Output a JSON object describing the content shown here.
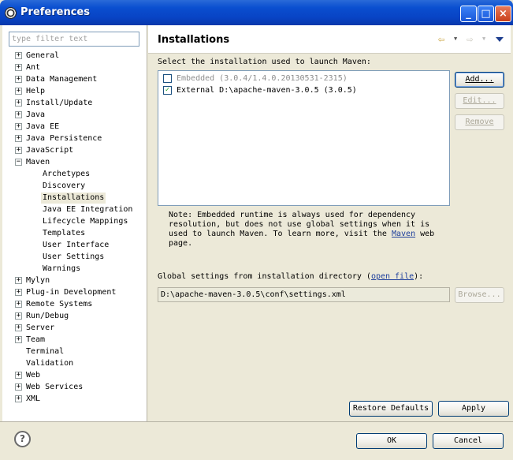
{
  "window": {
    "title": "Preferences"
  },
  "filter": {
    "placeholder": "type filter text"
  },
  "tree": [
    {
      "label": "General",
      "expandable": true
    },
    {
      "label": "Ant",
      "expandable": true
    },
    {
      "label": "Data Management",
      "expandable": true
    },
    {
      "label": "Help",
      "expandable": true
    },
    {
      "label": "Install/Update",
      "expandable": true
    },
    {
      "label": "Java",
      "expandable": true
    },
    {
      "label": "Java EE",
      "expandable": true
    },
    {
      "label": "Java Persistence",
      "expandable": true
    },
    {
      "label": "JavaScript",
      "expandable": true
    },
    {
      "label": "Maven",
      "expandable": true,
      "expanded": true
    },
    {
      "label": "Archetypes",
      "child": true
    },
    {
      "label": "Discovery",
      "child": true
    },
    {
      "label": "Installations",
      "child": true,
      "selected": true
    },
    {
      "label": "Java EE Integration",
      "child": true
    },
    {
      "label": "Lifecycle Mappings",
      "child": true
    },
    {
      "label": "Templates",
      "child": true
    },
    {
      "label": "User Interface",
      "child": true
    },
    {
      "label": "User Settings",
      "child": true
    },
    {
      "label": "Warnings",
      "child": true
    },
    {
      "label": "Mylyn",
      "expandable": true
    },
    {
      "label": "Plug-in Development",
      "expandable": true
    },
    {
      "label": "Remote Systems",
      "expandable": true
    },
    {
      "label": "Run/Debug",
      "expandable": true
    },
    {
      "label": "Server",
      "expandable": true
    },
    {
      "label": "Team",
      "expandable": true
    },
    {
      "label": "Terminal",
      "expandable": false
    },
    {
      "label": "Validation",
      "expandable": false
    },
    {
      "label": "Web",
      "expandable": true
    },
    {
      "label": "Web Services",
      "expandable": true
    },
    {
      "label": "XML",
      "expandable": true
    }
  ],
  "page": {
    "title": "Installations",
    "select_label": "Select the installation used to launch Maven:",
    "installations": [
      {
        "label": "Embedded (3.0.4/1.4.0.20130531-2315)",
        "checked": false,
        "disabled": true
      },
      {
        "label": "External D:\\apache-maven-3.0.5 (3.0.5)",
        "checked": true,
        "disabled": false
      }
    ],
    "buttons": {
      "add": "Add...",
      "edit": "Edit...",
      "remove": "Remove"
    },
    "note_prefix": "Note: Embedded runtime is always used for dependency resolution, but does not use global settings when it is used to launch Maven. To learn more, visit the",
    "note_link": "Maven",
    "note_suffix": "web page.",
    "global_label_prefix": "Global settings from installation directory (",
    "global_link": "open file",
    "global_label_suffix": "):",
    "settings_path": "D:\\apache-maven-3.0.5\\conf\\settings.xml",
    "browse": "Browse...",
    "restore_defaults": "Restore Defaults",
    "apply": "Apply"
  },
  "footer": {
    "ok": "OK",
    "cancel": "Cancel"
  },
  "icons": {
    "back": "back-arrow-icon",
    "forward": "forward-arrow-icon",
    "menu": "view-menu-icon",
    "help": "help-icon",
    "app": "eclipse-icon"
  }
}
